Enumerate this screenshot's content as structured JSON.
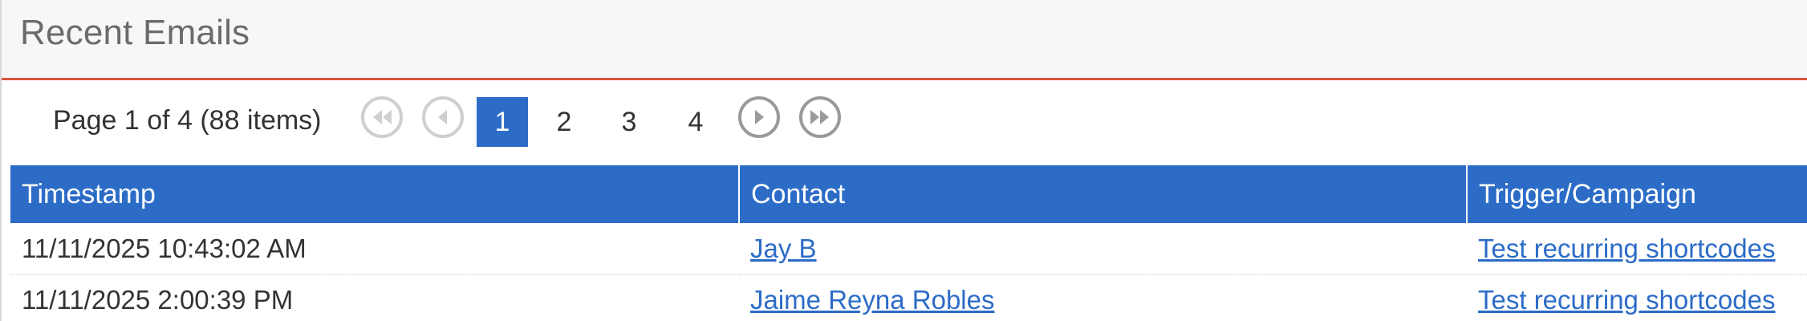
{
  "panel": {
    "title": "Recent Emails",
    "accent_color": "#d9553b",
    "header_color": "#2c6cc7"
  },
  "pager": {
    "summary": "Page 1 of 4 (88 items)",
    "pages": [
      "1",
      "2",
      "3",
      "4"
    ],
    "current_page": "1",
    "icons": [
      "first-page-icon",
      "prev-page-icon",
      "next-page-icon",
      "last-page-icon"
    ]
  },
  "table": {
    "columns": [
      "Timestamp",
      "Contact",
      "Trigger/Campaign"
    ],
    "rows": [
      {
        "timestamp": "11/11/2025 10:43:02 AM",
        "contact": "Jay B",
        "trigger": "Test recurring shortcodes"
      },
      {
        "timestamp": "11/11/2025 2:00:39 PM",
        "contact": "Jaime Reyna Robles",
        "trigger": "Test recurring shortcodes"
      }
    ]
  }
}
